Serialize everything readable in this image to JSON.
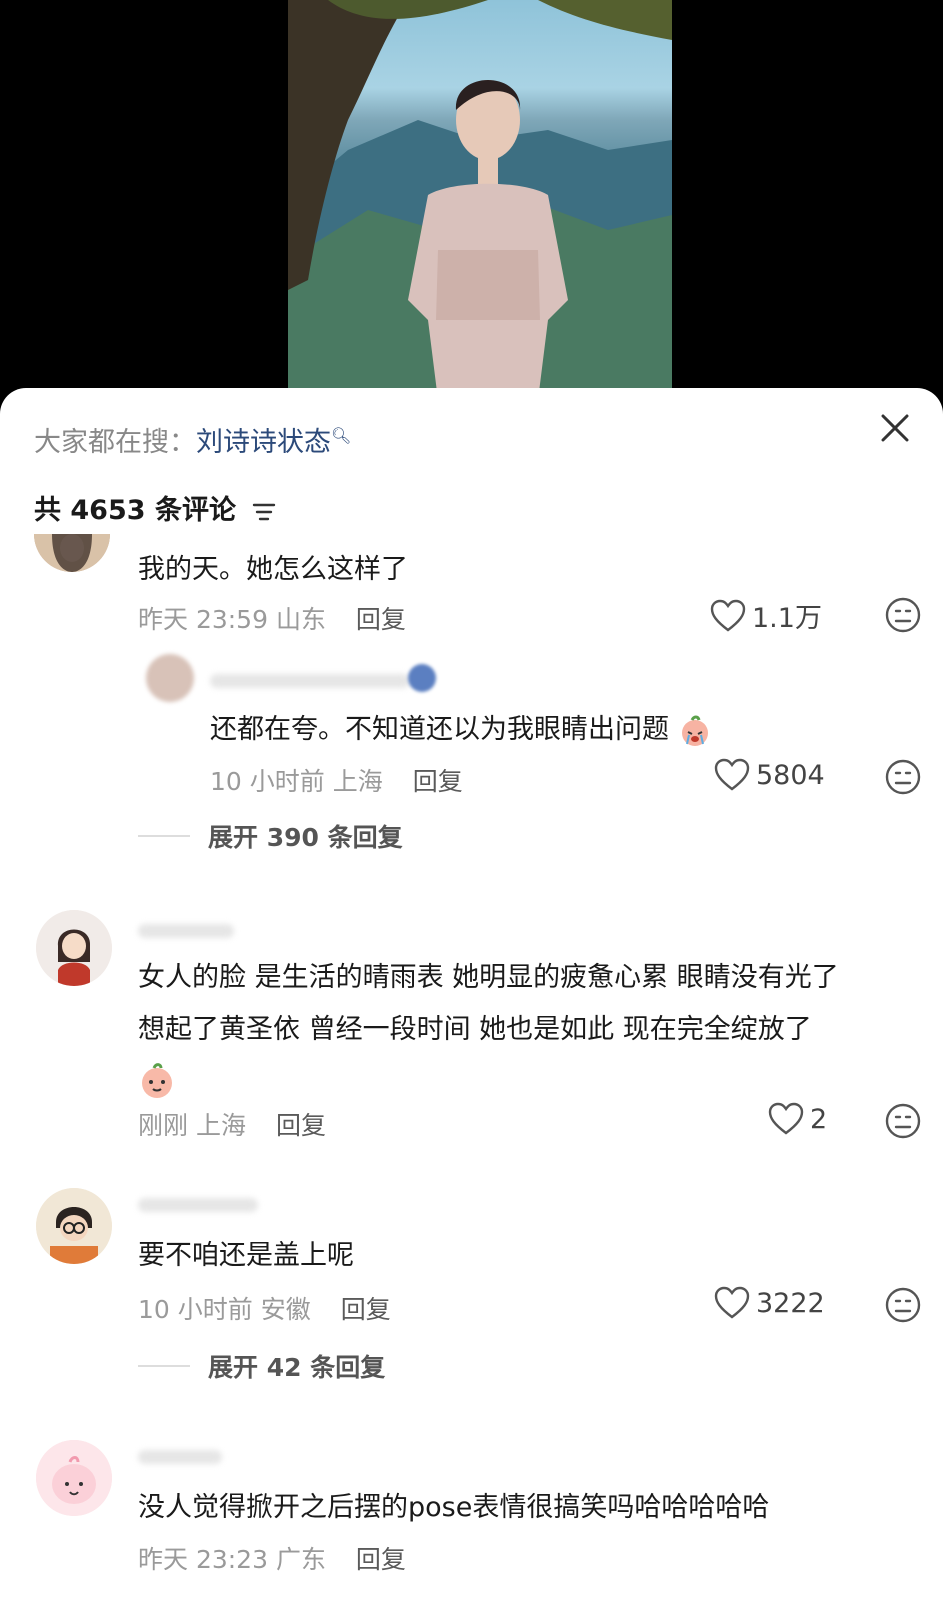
{
  "search": {
    "prefix": "大家都在搜：",
    "term": "刘诗诗状态"
  },
  "comment_count": "共 4653 条评论",
  "comments": [
    {
      "text": "我的天。她怎么这样了",
      "time": "昨天 23:59",
      "location": "山东",
      "reply": "回复",
      "likes": "1.1万"
    },
    {
      "text": "还都在夸。不知道还以为我眼睛出问题",
      "time": "10 小时前",
      "location": "上海",
      "reply": "回复",
      "likes": "5804",
      "expand": "展开 390 条回复"
    },
    {
      "text_line1": "女人的脸 是生活的晴雨表 她明显的疲惫心累 眼睛没有光了",
      "text_line2": "想起了黄圣依 曾经一段时间 她也是如此 现在完全绽放了",
      "time": "刚刚",
      "location": "上海",
      "reply": "回复",
      "likes": "2"
    },
    {
      "text": "要不咱还是盖上呢",
      "time": "10 小时前",
      "location": "安徽",
      "reply": "回复",
      "likes": "3222",
      "expand": "展开 42 条回复"
    },
    {
      "text": "没人觉得掀开之后摆的pose表情很搞笑吗哈哈哈哈哈",
      "time": "昨天 23:23",
      "location": "广东",
      "reply": "回复"
    }
  ],
  "icons": {
    "close": "close-icon",
    "filter": "filter-icon",
    "like": "heart-icon",
    "dislike": "dislike-face-icon"
  },
  "colors": {
    "link": "#2c4a7a",
    "meta": "#9a9a9a",
    "sheet": "#ffffff"
  }
}
